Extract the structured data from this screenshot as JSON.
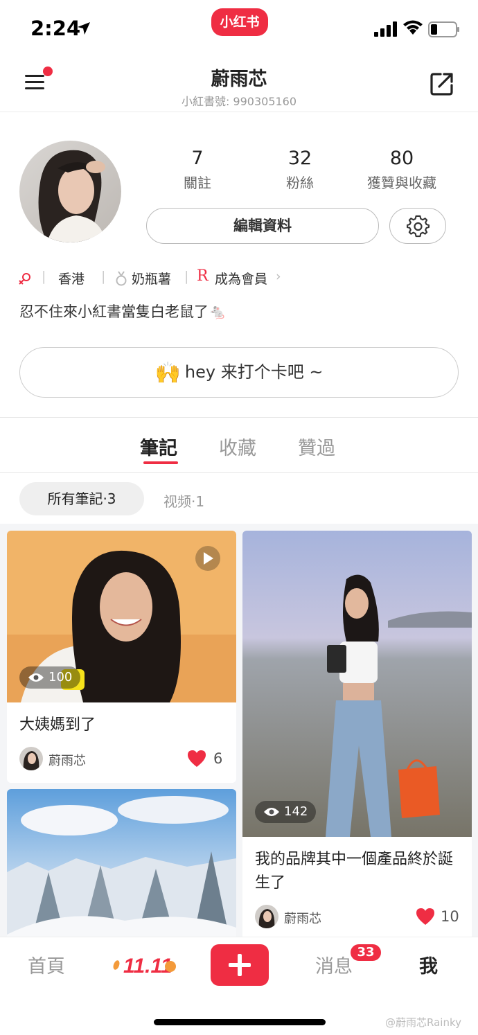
{
  "status_bar": {
    "time": "2:24",
    "app_badge": "小红书"
  },
  "header": {
    "name": "蔚雨芯",
    "id": "小紅書號: 990305160"
  },
  "stats": [
    {
      "value": "7",
      "label": "關註"
    },
    {
      "value": "32",
      "label": "粉絲"
    },
    {
      "value": "80",
      "label": "獲贊與收藏"
    }
  ],
  "profile": {
    "edit_label": "編輯資料",
    "location": "香港",
    "badge_label": "奶瓶薯",
    "member_label": "成為會員",
    "bio": "忍不住來小紅書當隻白老鼠了🐁",
    "checkin_text": "hey 来打个卡吧 ~"
  },
  "tabs": [
    "筆記",
    "收藏",
    "贊過"
  ],
  "filters": {
    "all": "所有筆記·3",
    "video": "视频·1"
  },
  "notes": [
    {
      "title": "大姨媽到了",
      "author": "蔚雨芯",
      "likes": "6",
      "views": "100"
    },
    {
      "title": "我的品牌其中一個產品終於誕生了",
      "author": "蔚雨芯",
      "likes": "10",
      "views": "142"
    }
  ],
  "bottom_nav": {
    "home": "首頁",
    "promo": "11.11",
    "messages": "消息",
    "messages_badge": "33",
    "me": "我"
  },
  "watermark": "@蔚雨芯Rainky",
  "colors": {
    "accent": "#ef2d43"
  }
}
